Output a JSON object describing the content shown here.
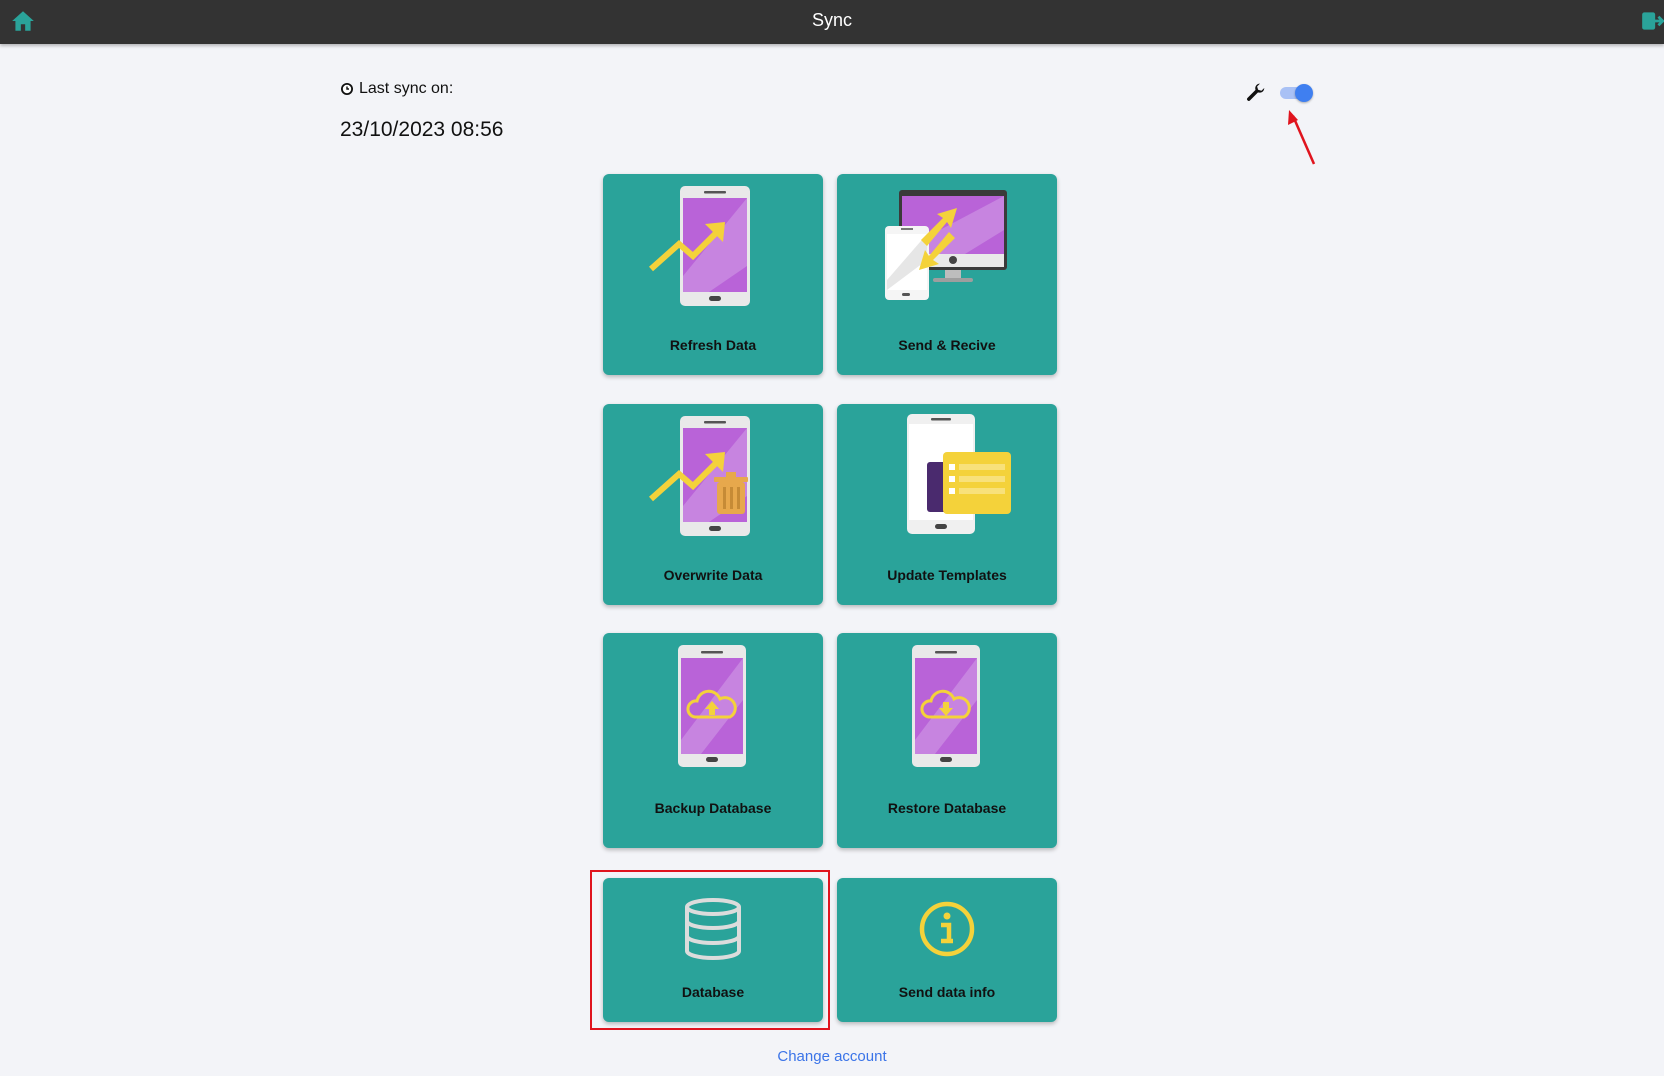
{
  "header": {
    "title": "Sync",
    "home_icon": "home-icon",
    "logout_icon": "logout-icon",
    "icon_color": "#2aa39a"
  },
  "sync": {
    "label": "Last sync on:",
    "date": "23/10/2023 08:56"
  },
  "settings": {
    "wrench_icon": "wrench-icon",
    "toggle_on": true
  },
  "tiles": [
    {
      "label": "Refresh Data",
      "icon": "phone-chart-icon"
    },
    {
      "label": "Send & Recive",
      "icon": "devices-sync-icon"
    },
    {
      "label": "Overwrite Data",
      "icon": "phone-chart-trash-icon"
    },
    {
      "label": "Update Templates",
      "icon": "phone-template-icon"
    },
    {
      "label": "Backup Database",
      "icon": "phone-cloud-upload-icon"
    },
    {
      "label": "Restore Database",
      "icon": "phone-cloud-download-icon"
    },
    {
      "label": "Database",
      "icon": "database-icon"
    },
    {
      "label": "Send data info",
      "icon": "info-icon"
    }
  ],
  "footer": {
    "change_account": "Change account"
  },
  "colors": {
    "topbar": "#333333",
    "tile": "#2aa39a",
    "link": "#3b74e8",
    "annotation": "#e0141e",
    "toggle": "#3f7ff0"
  }
}
